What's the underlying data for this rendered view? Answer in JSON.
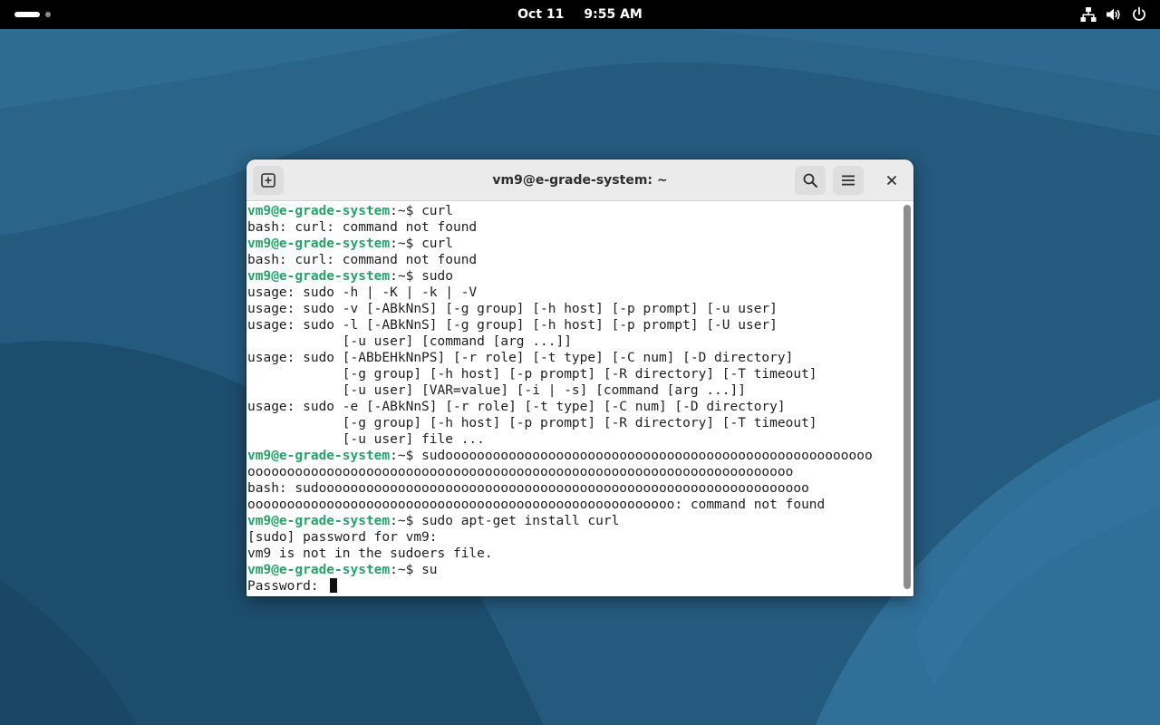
{
  "topbar": {
    "date": "Oct 11",
    "time": "9:55 AM",
    "icons": [
      "network-icon",
      "volume-icon",
      "power-icon"
    ]
  },
  "window": {
    "title": "vm9@e-grade-system: ~",
    "buttons": [
      "new-tab-icon",
      "search-icon",
      "hamburger-menu-icon",
      "close-icon"
    ]
  },
  "terminal": {
    "prompt": {
      "user_host": "vm9@e-grade-system",
      "separator": ":",
      "path": "~$"
    },
    "lines": [
      {
        "type": "prompt",
        "text": " curl"
      },
      {
        "type": "output",
        "text": "bash: curl: command not found"
      },
      {
        "type": "prompt",
        "text": " curl"
      },
      {
        "type": "output",
        "text": "bash: curl: command not found"
      },
      {
        "type": "prompt",
        "text": " sudo"
      },
      {
        "type": "output",
        "text": "usage: sudo -h | -K | -k | -V"
      },
      {
        "type": "output",
        "text": "usage: sudo -v [-ABkNnS] [-g group] [-h host] [-p prompt] [-u user]"
      },
      {
        "type": "output",
        "text": "usage: sudo -l [-ABkNnS] [-g group] [-h host] [-p prompt] [-U user]"
      },
      {
        "type": "output",
        "text": "            [-u user] [command [arg ...]]"
      },
      {
        "type": "output",
        "text": "usage: sudo [-ABbEHkNnPS] [-r role] [-t type] [-C num] [-D directory]"
      },
      {
        "type": "output",
        "text": "            [-g group] [-h host] [-p prompt] [-R directory] [-T timeout]"
      },
      {
        "type": "output",
        "text": "            [-u user] [VAR=value] [-i | -s] [command [arg ...]]"
      },
      {
        "type": "output",
        "text": "usage: sudo -e [-ABkNnS] [-r role] [-t type] [-C num] [-D directory]"
      },
      {
        "type": "output",
        "text": "            [-g group] [-h host] [-p prompt] [-R directory] [-T timeout]"
      },
      {
        "type": "output",
        "text": "            [-u user] file ..."
      },
      {
        "type": "prompt",
        "text": " sudoooooooooooooooooooooooooooooooooooooooooooooooooooooo"
      },
      {
        "type": "output",
        "text": "ooooooooooooooooooooooooooooooooooooooooooooooooooooooooooooooooooooo"
      },
      {
        "type": "output",
        "text": "bash: sudoooooooooooooooooooooooooooooooooooooooooooooooooooooooooooooo"
      },
      {
        "type": "output",
        "text": "oooooooooooooooooooooooooooooooooooooooooooooooooooooo: command not found"
      },
      {
        "type": "prompt",
        "text": " sudo apt-get install curl"
      },
      {
        "type": "output",
        "text": "[sudo] password for vm9:"
      },
      {
        "type": "output",
        "text": "vm9 is not in the sudoers file."
      },
      {
        "type": "prompt",
        "text": " su"
      },
      {
        "type": "input",
        "text": "Password: "
      }
    ]
  },
  "colors": {
    "prompt_user": "#26a269",
    "topbar": "#000000",
    "wallpaper": "#24577a"
  }
}
